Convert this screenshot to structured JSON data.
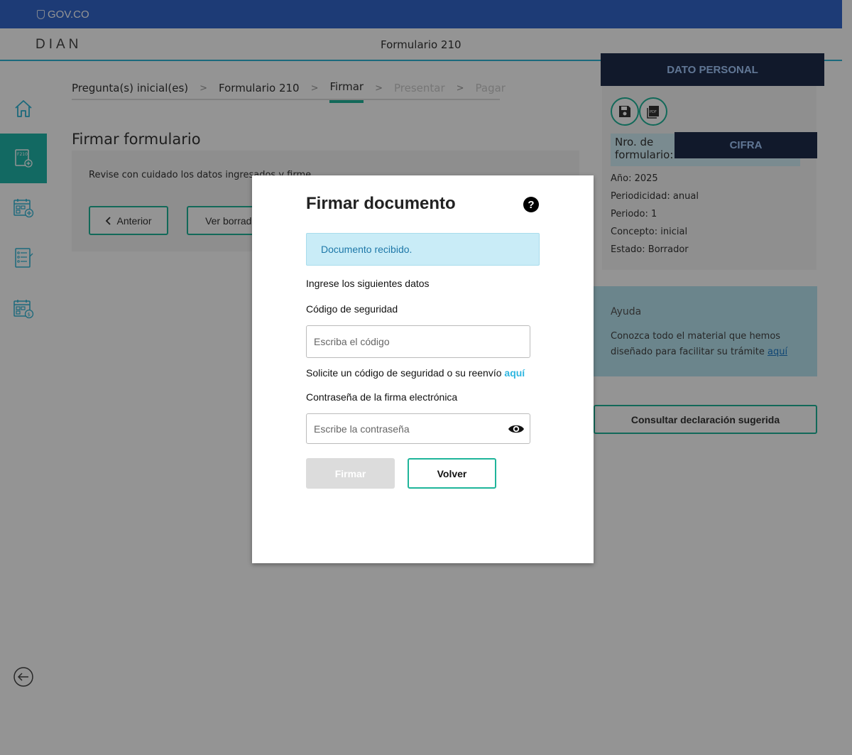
{
  "gov": {
    "logo_text": "GOV.CO"
  },
  "header": {
    "brand": "DIAN",
    "title": "Formulario 210"
  },
  "sidebar": {
    "items": [
      {
        "icon": "home-icon"
      },
      {
        "icon": "form-210-add-icon",
        "active": true
      },
      {
        "icon": "calendar-add-icon"
      },
      {
        "icon": "checklist-icon"
      },
      {
        "icon": "calendar-payment-icon"
      }
    ],
    "back_icon": "back-arrow-icon"
  },
  "steps": [
    {
      "label": "Pregunta(s) inicial(es)",
      "state": "done"
    },
    {
      "label": "Formulario 210",
      "state": "done"
    },
    {
      "label": "Firmar",
      "state": "current"
    },
    {
      "label": "Presentar",
      "state": "disabled"
    },
    {
      "label": "Pagar",
      "state": "disabled"
    }
  ],
  "main": {
    "title": "Firmar formulario",
    "instructions": "Revise con cuidado los datos ingresados y firme.",
    "previous_button": "Anterior",
    "draft_button": "Ver borrador"
  },
  "right_panel": {
    "redacted_name": "DATO PERSONAL",
    "form_number_label": "Nro. de formulario:",
    "form_number_redacted": "CIFRA",
    "meta": [
      {
        "label": "Año:",
        "value": "2025"
      },
      {
        "label": "Periodicidad:",
        "value": "anual"
      },
      {
        "label": "Periodo:",
        "value": "1"
      },
      {
        "label": "Concepto:",
        "value": "inicial"
      },
      {
        "label": "Estado:",
        "value": "Borrador"
      }
    ]
  },
  "help": {
    "title": "Ayuda",
    "text": "Conozca todo el material que hemos diseñado para facilitar su trámite",
    "link": "aquí"
  },
  "suggested_button": "Consultar declaración sugerida",
  "modal": {
    "title": "Firmar documento",
    "alert": "Documento recibido.",
    "intro": "Ingrese los siguientes datos",
    "code_label": "Código de seguridad",
    "code_placeholder": "Escriba el código",
    "request_text": "Solicite un código de seguridad o su reenvío",
    "request_link": "aquí",
    "password_label": "Contraseña de la firma electrónica",
    "password_placeholder": "Escribe la contraseña",
    "sign_button": "Firmar",
    "back_button": "Volver"
  },
  "colors": {
    "gov_blue": "#3366cc",
    "accent_teal": "#1fb59a",
    "alert_bg": "#c9ecf7",
    "redaction": "#1e2b4a"
  }
}
